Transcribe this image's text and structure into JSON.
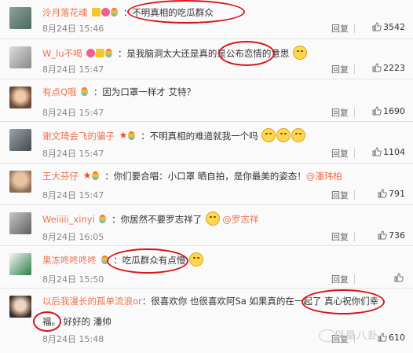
{
  "comments": [
    {
      "user": "泠月落花魂",
      "text": "不明真相的吃瓜群众",
      "time": "8月24日 15:46",
      "reply": "回复",
      "likes": "3542"
    },
    {
      "user": "W_lu不喝",
      "text_a": "：是我脑洞太大还是真的是公布恋情的意思",
      "time": "8月24日 15:47",
      "reply": "回复",
      "likes": "2223"
    },
    {
      "user": "有点Q哦",
      "text": "：因为口罩一样才 艾特？",
      "time": "8月24日 15:47",
      "reply": "回复",
      "likes": "1690"
    },
    {
      "user": "谢文琦会飞的骗子",
      "text": "：不明真相的难道就我一个吗",
      "time": "8月24日 15:47",
      "reply": "回复",
      "likes": "1104"
    },
    {
      "user": "王大芬仔",
      "text": "：你们要合唱：小口罩 晒自拍，是你最美的姿态！",
      "mention": "@潘玮柏",
      "time": "8月24日 15:47",
      "reply": "回复",
      "likes": "791"
    },
    {
      "user": "Weiiiii_xinyi",
      "text": "：你居然不要罗志祥了",
      "mention": "@罗志祥",
      "time": "8月24日 16:05",
      "reply": "回复",
      "likes": "736"
    },
    {
      "user": "果冻咚咚咚咚",
      "text": "：吃瓜群众有点懵",
      "time": "8月24日 15:50",
      "reply": "回复",
      "likes": ""
    },
    {
      "user": "以后我漫长的孤单流浪or",
      "text": "：很喜欢你 也很喜欢阿Sa 如果真的在一起了 真心祝你们幸",
      "text2": "福。 好好的 潘帅",
      "time": "8月24日 15:48",
      "reply": "回复",
      "likes": "610"
    }
  ],
  "watermark": "凤凰八卦"
}
